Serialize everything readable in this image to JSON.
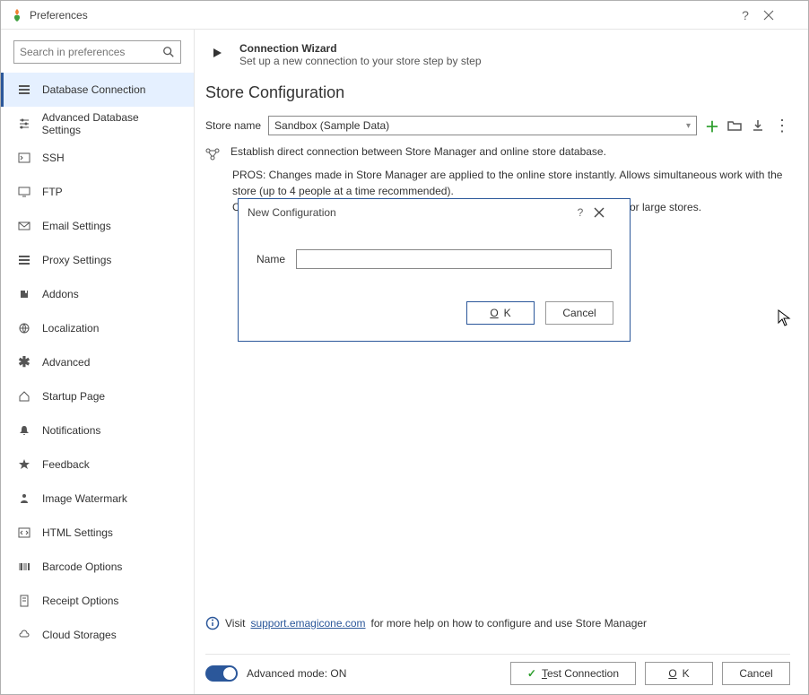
{
  "titlebar": {
    "title": "Preferences"
  },
  "search": {
    "placeholder": "Search in preferences"
  },
  "nav": [
    {
      "label": "Database Connection",
      "icon": "database"
    },
    {
      "label": "Advanced Database Settings",
      "icon": "sliders"
    },
    {
      "label": "SSH",
      "icon": "terminal"
    },
    {
      "label": "FTP",
      "icon": "monitor"
    },
    {
      "label": "Email Settings",
      "icon": "mail"
    },
    {
      "label": "Proxy Settings",
      "icon": "proxy"
    },
    {
      "label": "Addons",
      "icon": "puzzle"
    },
    {
      "label": "Localization",
      "icon": "globe"
    },
    {
      "label": "Advanced",
      "icon": "asterisk"
    },
    {
      "label": "Startup Page",
      "icon": "home"
    },
    {
      "label": "Notifications",
      "icon": "bell"
    },
    {
      "label": "Feedback",
      "icon": "star"
    },
    {
      "label": "Image Watermark",
      "icon": "person"
    },
    {
      "label": "HTML Settings",
      "icon": "code"
    },
    {
      "label": "Barcode Options",
      "icon": "barcode"
    },
    {
      "label": "Receipt Options",
      "icon": "receipt"
    },
    {
      "label": "Cloud Storages",
      "icon": "cloud"
    }
  ],
  "wizard": {
    "title": "Connection Wizard",
    "subtitle": "Set up a new connection to your store step by step"
  },
  "section": {
    "title": "Store Configuration"
  },
  "store": {
    "label": "Store name",
    "value": "Sandbox (Sample Data)"
  },
  "desc": {
    "main": "Establish direct connection between Store Manager and online store database.",
    "pros": "PROS: Changes made in Store Manager are applied to the online store instantly. Allows simultaneous work with the store (up to 4 people at a time recommended).",
    "cons_fragment_left": "CO",
    "cons_fragment_right": "or large stores."
  },
  "help": {
    "prefix": "Visit",
    "link": "support.emagicone.com",
    "suffix": "for more help on how to configure and use Store Manager"
  },
  "footer": {
    "advanced_label": "Advanced mode: ON",
    "test_prefix": "T",
    "test_rest": "est Connection",
    "ok_prefix": "O",
    "ok_rest": "K",
    "cancel": "Cancel"
  },
  "modal": {
    "title": "New Configuration",
    "name_label": "Name",
    "name_value": "",
    "ok_prefix": "O",
    "ok_rest": "K",
    "cancel": "Cancel"
  }
}
